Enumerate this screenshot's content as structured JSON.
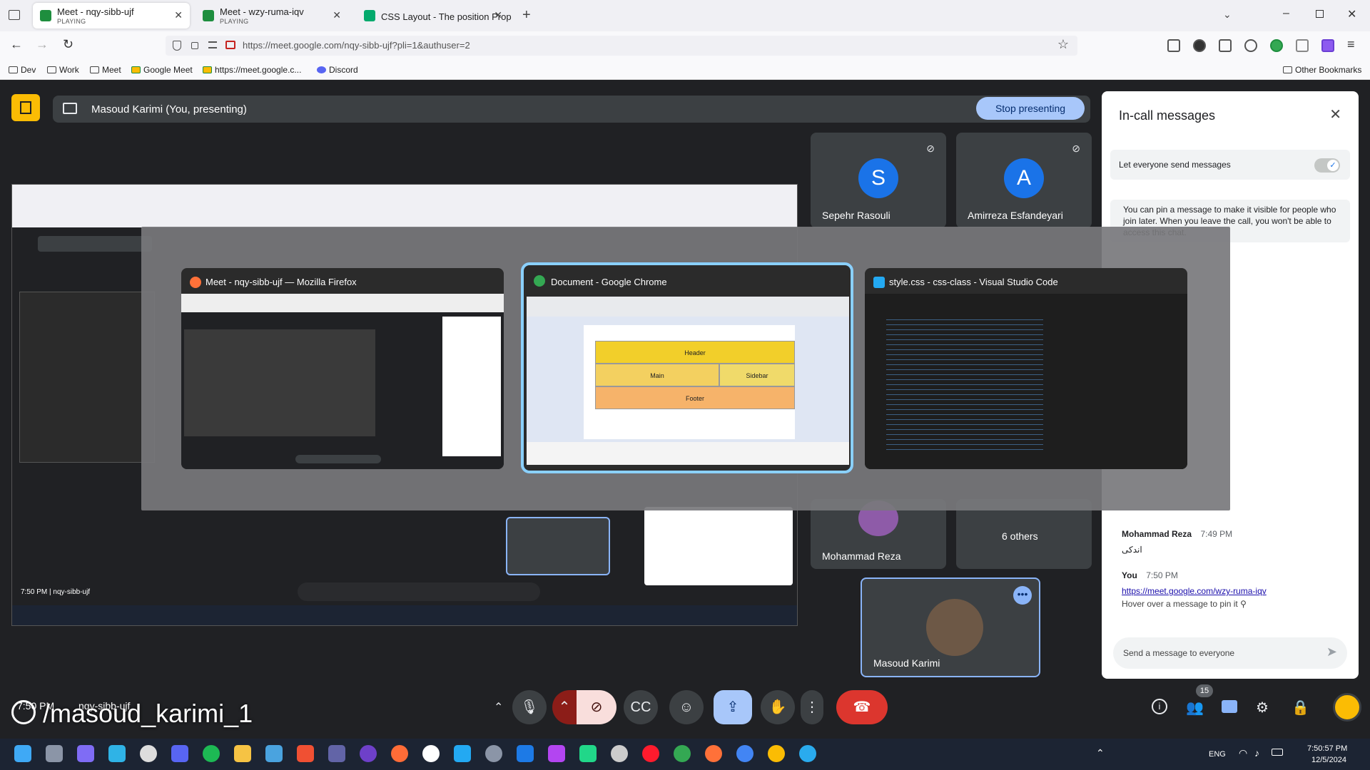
{
  "tabs": [
    {
      "title": "Meet - nqy-sibb-ujf",
      "status": "PLAYING"
    },
    {
      "title": "Meet - wzy-ruma-iqv",
      "status": "PLAYING"
    },
    {
      "title": "CSS Layout - The position Prop"
    }
  ],
  "url": "https://meet.google.com/nqy-sibb-ujf?pli=1&authuser=2",
  "bookmarks": [
    "Dev",
    "Work",
    "Meet",
    "Google Meet",
    "https://meet.google.c...",
    "Discord"
  ],
  "other_bookmarks": "Other Bookmarks",
  "meet": {
    "presenting_label": "Masoud Karimi (You, presenting)",
    "stop_presenting": "Stop presenting",
    "participants": [
      {
        "initial": "S",
        "name": "Sepehr Rasouli",
        "color": "#1a73e8"
      },
      {
        "initial": "A",
        "name": "Amirreza Esfandeyari",
        "color": "#1a73e8"
      },
      {
        "name": "Mohammad Reza"
      },
      {
        "name": "6 others"
      },
      {
        "name": "Masoud Karimi"
      }
    ],
    "time_code": "7:50 PM",
    "meeting_code": "nqy-sibb-ujf",
    "watermark": "/masoud_karimi_1",
    "people_count": "15"
  },
  "panel": {
    "title": "In-call messages",
    "toggle_label": "Let everyone send messages",
    "info": "You can pin a message to make it visible for people who join later. When you leave the call, you won't be able to access this chat.",
    "messages": [
      {
        "sender": "Mohammad Reza",
        "time": "7:49 PM",
        "text": "اندکی"
      },
      {
        "sender": "You",
        "time": "7:50 PM",
        "link": "https://meet.google.com/wzy-ruma-iqv",
        "hint": "Hover over a message to pin it"
      }
    ],
    "input_placeholder": "Send a message to everyone"
  },
  "switcher": [
    {
      "title": "Meet - nqy-sibb-ujf — Mozilla Firefox"
    },
    {
      "title": "Document - Google Chrome"
    },
    {
      "title": "style.css - css-class - Visual Studio Code"
    }
  ],
  "doc_preview": {
    "header": "Header",
    "main": "Main",
    "sidebar": "Sidebar",
    "footer": "Footer"
  },
  "taskbar": {
    "lang": "ENG",
    "time": "7:50:57 PM",
    "date": "12/5/2024"
  },
  "colors": {
    "accent": "#a8c7fa",
    "end_call": "#dc362e",
    "logo": "#fbbc04"
  }
}
